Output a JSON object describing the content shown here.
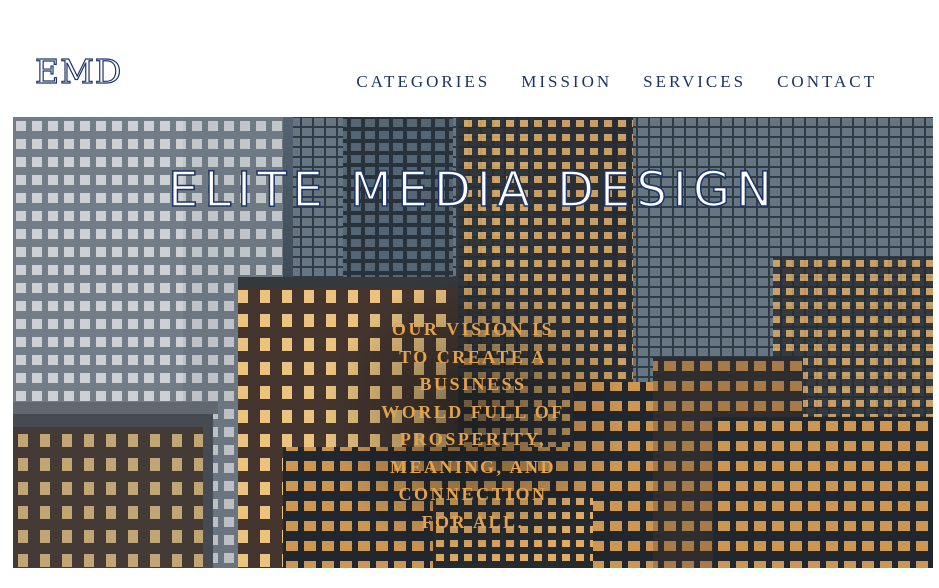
{
  "header": {
    "logo": "EMD",
    "nav": [
      "CATEGORIES",
      "MISSION",
      "SERVICES",
      "CONTACT"
    ]
  },
  "hero": {
    "title": "ELITE MEDIA DESIGN",
    "vision_lines": [
      "OUR VISION IS",
      "TO CREATE A",
      "BUSINESS",
      "WORLD FULL OF",
      "PROSPERITY,",
      "MEANING, AND",
      "CONNECTION",
      "FOR ALL."
    ]
  },
  "colors": {
    "brand_navy": "#1c3467",
    "vision_gold": "#e3a24b"
  }
}
